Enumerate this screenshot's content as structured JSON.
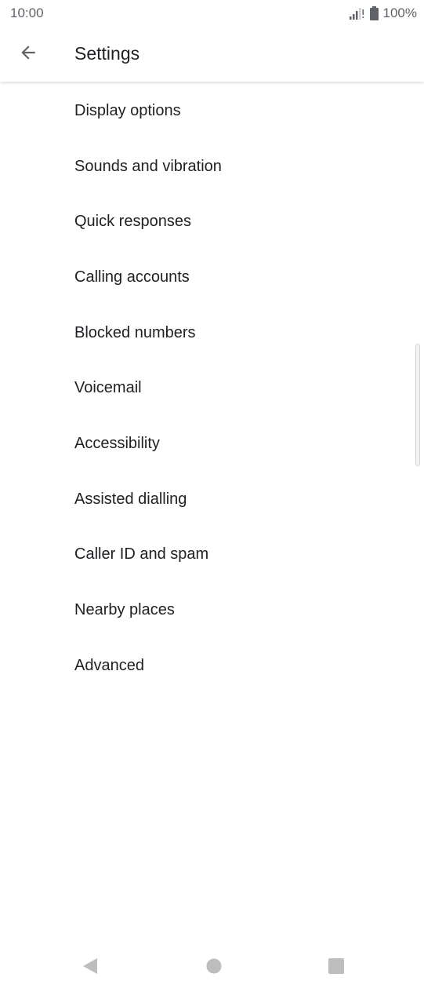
{
  "status_bar": {
    "time": "10:00",
    "battery_percent": "100%",
    "icons": [
      "signal-icon",
      "battery-icon"
    ]
  },
  "app_bar": {
    "title": "Settings",
    "back_icon": "arrow-back-icon"
  },
  "settings": {
    "items": [
      {
        "label": "Display options"
      },
      {
        "label": "Sounds and vibration"
      },
      {
        "label": "Quick responses"
      },
      {
        "label": "Calling accounts"
      },
      {
        "label": "Blocked numbers"
      },
      {
        "label": "Voicemail"
      },
      {
        "label": "Accessibility"
      },
      {
        "label": "Assisted dialling"
      },
      {
        "label": "Caller ID and spam"
      },
      {
        "label": "Nearby places"
      },
      {
        "label": "Advanced"
      }
    ]
  },
  "nav_bar": {
    "icons": [
      "nav-back-icon",
      "nav-home-icon",
      "nav-recents-icon"
    ]
  },
  "colors": {
    "text_primary": "#202124",
    "text_secondary": "#5f6368",
    "nav_icon": "#bdbdbd",
    "background": "#ffffff"
  }
}
